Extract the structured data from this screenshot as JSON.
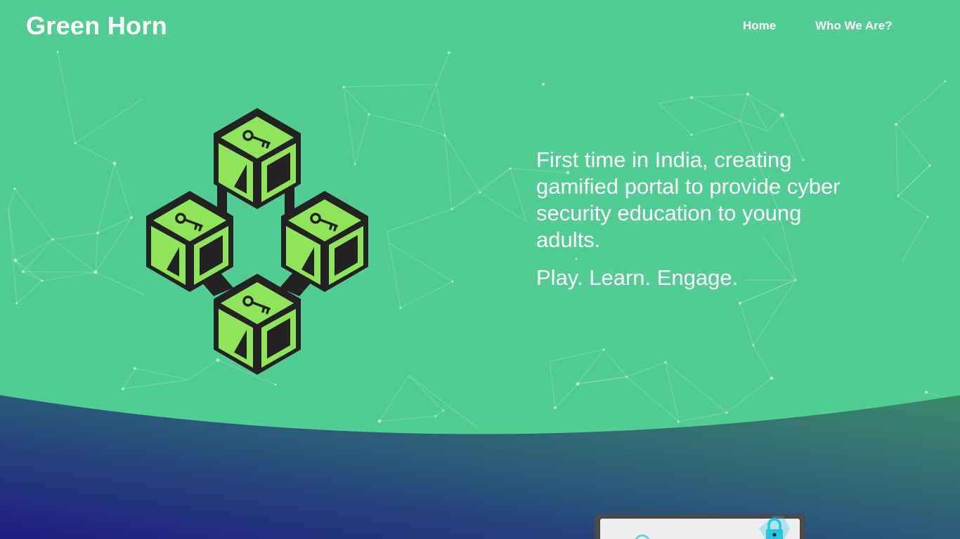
{
  "brand": {
    "name": "Green Horn"
  },
  "nav": {
    "items": [
      {
        "label": "Home"
      },
      {
        "label": "Who We Are?"
      }
    ]
  },
  "hero": {
    "tagline": "First time in India, creating gamified portal to provide cyber security education to young adults.",
    "motto": "Play. Learn. Engage."
  },
  "colors": {
    "hero_bg": "#51cc93",
    "cube_green": "#8ee55a",
    "cube_dark": "#222222",
    "wave_start": "#1e1a82",
    "wave_mid": "#2b5a7a",
    "wave_end": "#3c8a6a",
    "lock_cyan": "#25c7e0"
  },
  "icons": {
    "block_icon": "blockchain-cubes-key-icon",
    "lock_icon": "padlock-icon"
  }
}
